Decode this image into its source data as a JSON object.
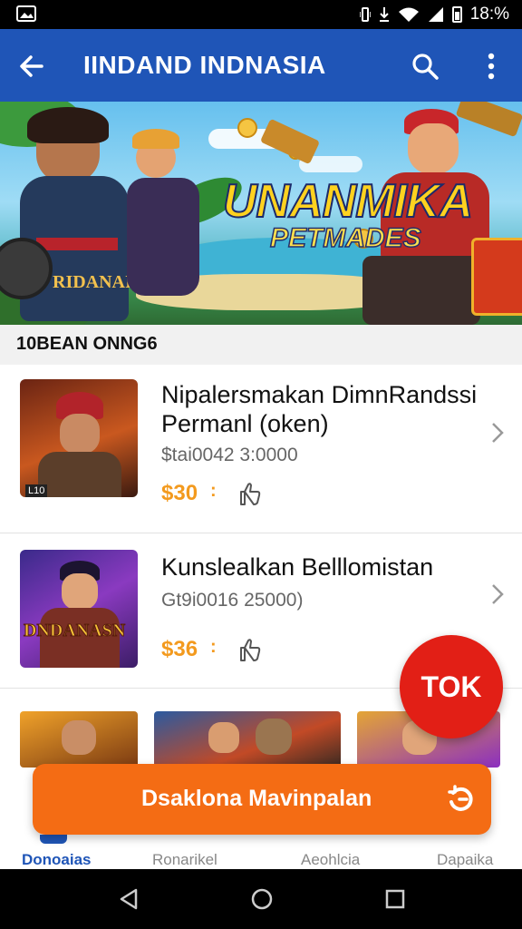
{
  "status_bar": {
    "time": "18:%",
    "icons": [
      "image-icon",
      "vibrate-icon",
      "download-icon",
      "wifi-icon",
      "signal-icon",
      "battery-icon"
    ]
  },
  "app_bar": {
    "title": "IINDAND INDNASIA",
    "icons": [
      "back-arrow-icon",
      "search-icon",
      "more-vert-icon"
    ]
  },
  "banner": {
    "title_line1": "UNANMIKA",
    "title_line2": "PETMADES",
    "shirt_text": "RIDANAIS"
  },
  "section": {
    "title": "10BEAN ONNG6"
  },
  "items": [
    {
      "name_line1": "Nipalersmakan DimnRandssi",
      "name_line2": "Permanl (oken)",
      "subtitle": "$tai0042 3:0000",
      "price": "$30",
      "thumb_badge": "L10"
    },
    {
      "name_line1": "Kunslealkan Belllomistan",
      "subtitle": "Gt9i0016 25000)",
      "price": "$36",
      "thumb_title": "DNDANASN"
    }
  ],
  "fab": {
    "label": "TOK"
  },
  "cta": {
    "label": "Dsaklona Mavinpalan"
  },
  "bottom_nav": [
    {
      "label": "Donoaias",
      "active": true
    },
    {
      "label": "Ronarikel",
      "active": false
    },
    {
      "label": "Aeohlcia",
      "active": false
    },
    {
      "label": "Dapaika",
      "active": false
    }
  ],
  "colors": {
    "primary": "#1f55b7",
    "price": "#f39a1e",
    "fab": "#e21f16",
    "cta": "#f46c14"
  }
}
